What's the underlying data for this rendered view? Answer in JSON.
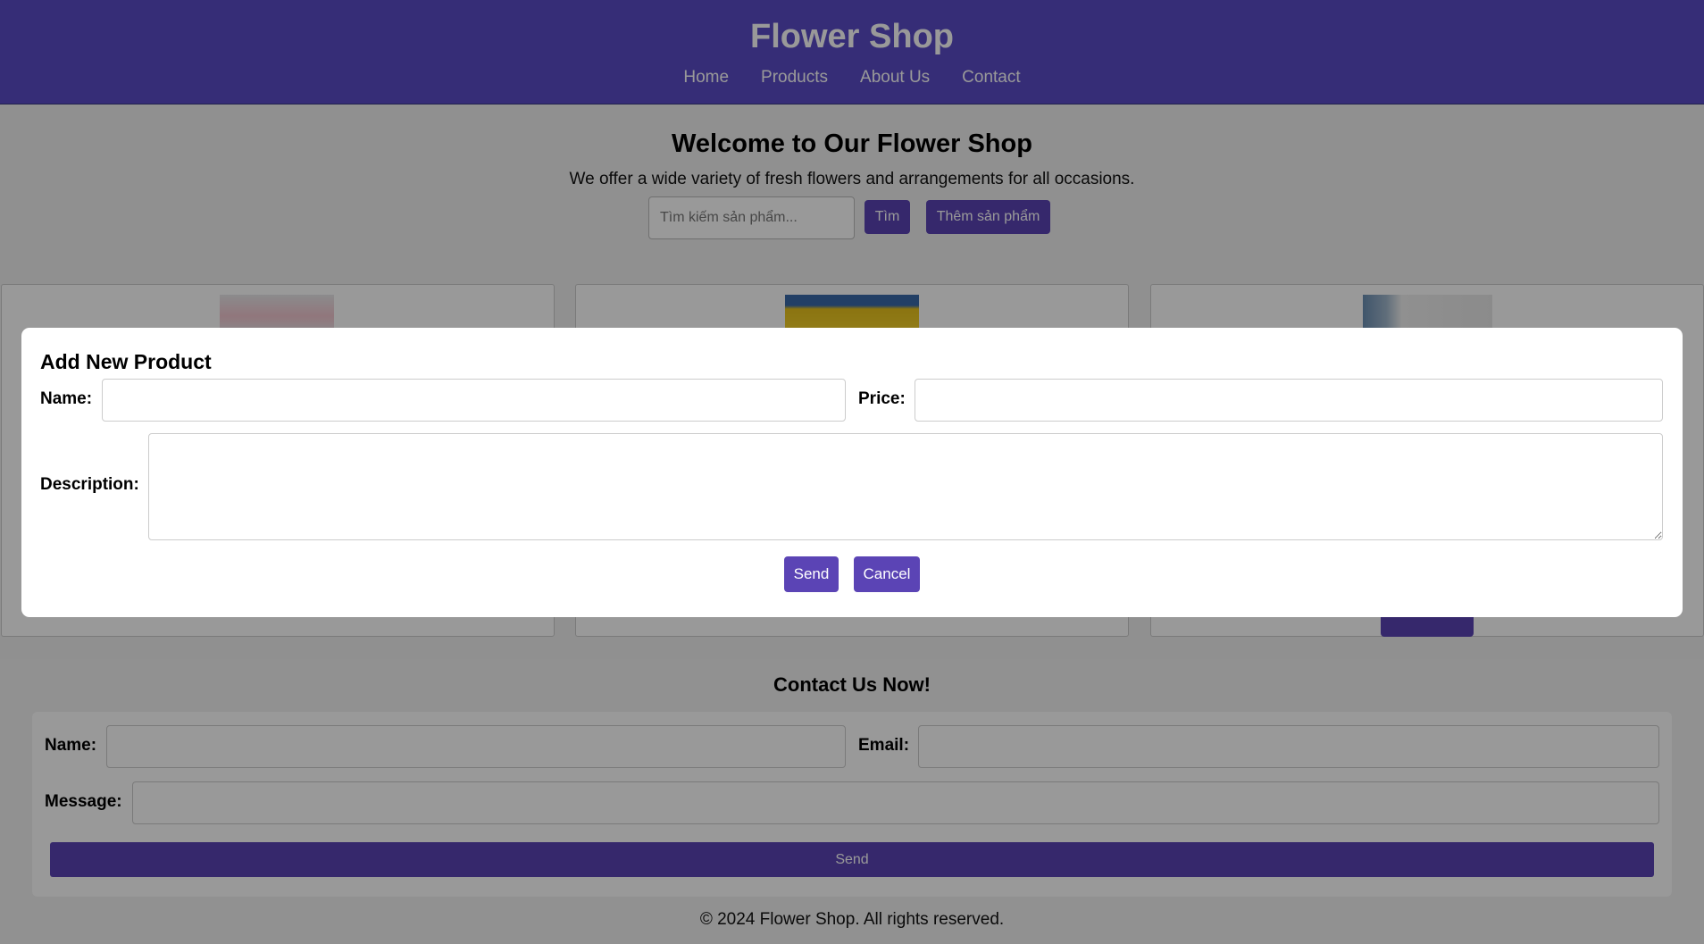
{
  "header": {
    "title": "Flower Shop",
    "nav": [
      "Home",
      "Products",
      "About Us",
      "Contact"
    ]
  },
  "hero": {
    "title": "Welcome to Our Flower Shop",
    "text": "We offer a wide variety of fresh flowers and arrangements for all occasions.",
    "search_placeholder": "Tìm kiếm sản phẩm...",
    "search_button": "Tìm",
    "add_button": "Thêm sản phẩm"
  },
  "contact": {
    "title": "Contact Us Now!",
    "name_label": "Name:",
    "email_label": "Email:",
    "message_label": "Message:",
    "send_label": "Send"
  },
  "footer": {
    "text": "© 2024 Flower Shop. All rights reserved."
  },
  "modal": {
    "title": "Add New Product",
    "name_label": "Name:",
    "price_label": "Price:",
    "description_label": "Description:",
    "send_label": "Send",
    "cancel_label": "Cancel"
  },
  "colors": {
    "header_bg": "#5b4bc7",
    "button_bg": "#5b44b5"
  }
}
